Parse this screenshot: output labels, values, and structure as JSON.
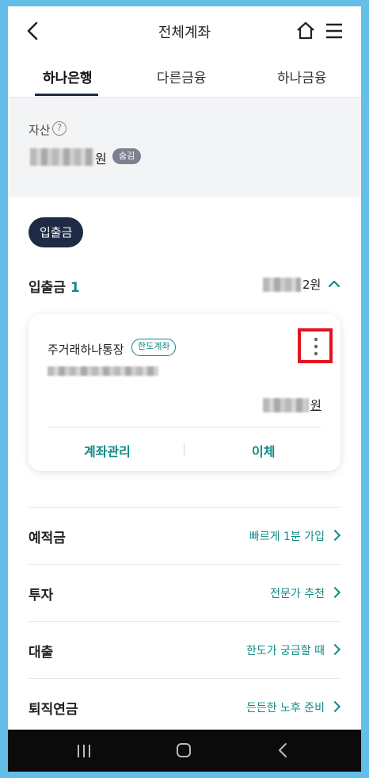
{
  "header": {
    "title": "전체계좌"
  },
  "tabs": [
    {
      "label": "하나은행",
      "active": true
    },
    {
      "label": "다른금융",
      "active": false
    },
    {
      "label": "하나금융",
      "active": false
    }
  ],
  "asset": {
    "label": "자산",
    "help_icon": "?",
    "unit": "원",
    "hide_label": "숨김"
  },
  "category_chip": "입출금",
  "deposit_section": {
    "title": "입출금",
    "count": "1",
    "amount_suffix": "2원"
  },
  "account_card": {
    "name": "주거래하나통장",
    "badge": "한도계좌",
    "balance_unit": "원",
    "manage_label": "계좌관리",
    "transfer_label": "이체"
  },
  "product_rows": [
    {
      "label": "예적금",
      "link": "빠르게 1분 가입"
    },
    {
      "label": "투자",
      "link": "전문가 추천"
    },
    {
      "label": "대출",
      "link": "한도가 궁금할 때"
    },
    {
      "label": "퇴직연금",
      "link": "든든한 노후 준비"
    }
  ],
  "icons": [
    "back-arrow-icon",
    "home-icon",
    "hamburger-menu-icon",
    "help-icon",
    "chevron-up-icon",
    "more-vertical-icon",
    "chevron-right-icon",
    "nav-recents-icon",
    "nav-home-icon",
    "nav-back-icon"
  ],
  "colors": {
    "accent": "#0f8b85",
    "navy": "#1f2a44",
    "highlight": "#e4141f",
    "background": "#63bfe8"
  }
}
